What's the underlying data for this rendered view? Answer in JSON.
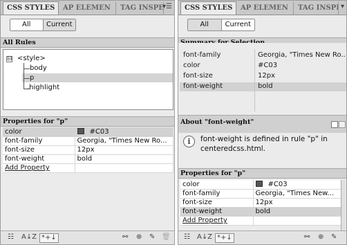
{
  "left": {
    "tabs": [
      "CSS STYLES",
      "AP ELEMEN",
      "TAG INSPE"
    ],
    "toggle": {
      "all": "All",
      "current": "Current"
    },
    "all_rules_header": "All Rules",
    "tree": {
      "root": "<style>",
      "items": [
        "body",
        "p",
        ".highlight"
      ],
      "expander": "⊟"
    },
    "properties_header": "Properties for \"p\"",
    "properties": [
      {
        "name": "color",
        "value": "#C03",
        "swatch": "#555555"
      },
      {
        "name": "font-family",
        "value": "Georgia, \"Times New Ro..."
      },
      {
        "name": "font-size",
        "value": "12px"
      },
      {
        "name": "font-weight",
        "value": "bold"
      }
    ],
    "add_property": "Add Property",
    "toolbar": {
      "cat_view": "☷",
      "az_view": "A↓Z",
      "set_view": "*+↓",
      "link": "⚯",
      "new": "⊕",
      "edit": "✎",
      "delete": "🗑"
    }
  },
  "right": {
    "tabs": [
      "CSS STYLES",
      "AP ELEMEN",
      "TAG INSPE"
    ],
    "toggle": {
      "all": "All",
      "current": "Current"
    },
    "summary_header": "Summary for Selection",
    "summary": [
      {
        "name": "font-family",
        "value": "Georgia, \"Times New Ro..."
      },
      {
        "name": "color",
        "value": "#C03"
      },
      {
        "name": "font-size",
        "value": "12px"
      },
      {
        "name": "font-weight",
        "value": "bold"
      }
    ],
    "about_header": "About \"font-weight\"",
    "about_text": "font-weight is defined in rule \"p\" in centeredcss.html.",
    "properties_header": "Properties for \"p\"",
    "properties": [
      {
        "name": "color",
        "value": "#C03",
        "swatch": "#555555"
      },
      {
        "name": "font-family",
        "value": "Georgia, \"Times New..."
      },
      {
        "name": "font-size",
        "value": "12px"
      },
      {
        "name": "font-weight",
        "value": "bold"
      }
    ],
    "add_property": "Add Property",
    "toolbar": {
      "cat_view": "☷",
      "az_view": "A↓Z",
      "set_view": "*+↓",
      "link": "⚯",
      "new": "⊕",
      "edit": "✎"
    }
  },
  "colors": {
    "panel_bg": "#ebebeb",
    "tab_bar": "#c9c9c9",
    "header_bg": "#d0d0d0",
    "highlight_row": "#d2d2d2"
  }
}
